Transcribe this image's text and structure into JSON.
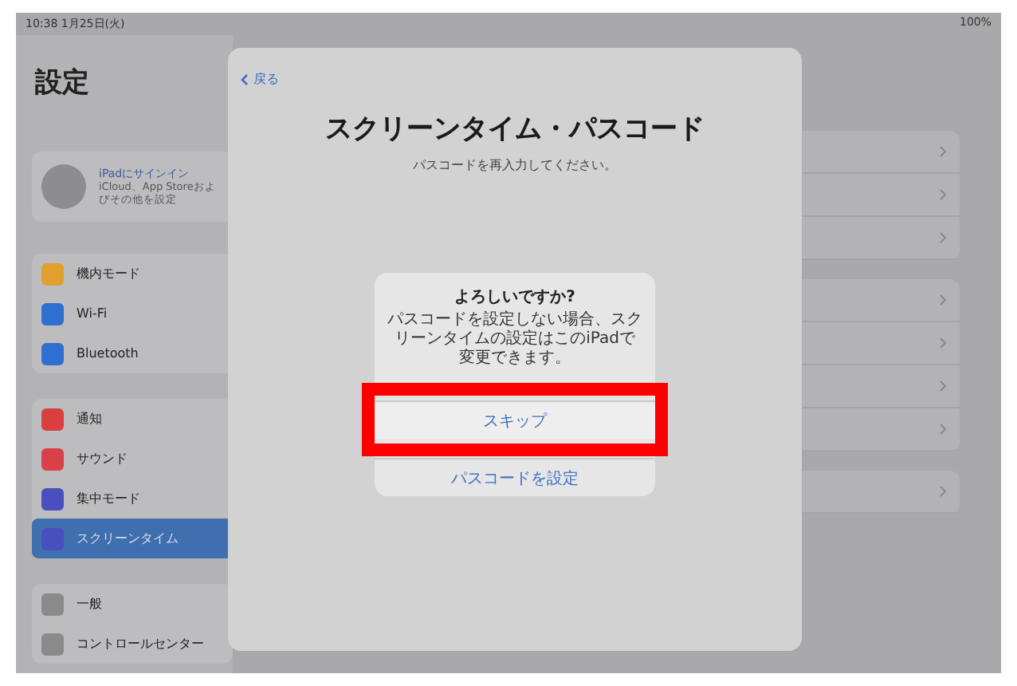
{
  "status_bar": {
    "time": "10:38 1月25日(火)",
    "battery": "100%"
  },
  "sidebar": {
    "title": "設定",
    "profile": {
      "name": "iPadにサインイン",
      "detail": "iCloud、App Storeおよびその他を設定"
    },
    "groups": [
      [
        {
          "label": "機内モード",
          "color": "#e0a030",
          "selected": false
        },
        {
          "label": "Wi-Fi",
          "color": "#2f6fd0",
          "selected": false
        },
        {
          "label": "Bluetooth",
          "color": "#2f6fd0",
          "selected": false
        }
      ],
      [
        {
          "label": "通知",
          "color": "#d84040",
          "selected": false
        },
        {
          "label": "サウンド",
          "color": "#d8404a",
          "selected": false
        },
        {
          "label": "集中モード",
          "color": "#4a4fc0",
          "selected": false
        },
        {
          "label": "スクリーンタイム",
          "color": "#4a4fc0",
          "selected": true
        }
      ],
      [
        {
          "label": "一般",
          "color": "#8a8a8a",
          "selected": false
        },
        {
          "label": "コントロールセンター",
          "color": "#8a8a8a",
          "selected": false
        }
      ]
    ]
  },
  "sheet": {
    "back": "戻る",
    "title": "スクリーンタイム・パスコード",
    "subtitle": "パスコードを再入力してください。",
    "alert": {
      "title": "よろしいですか?",
      "message": "パスコードを設定しない場合、スクリーンタイムの設定はこのiPadで変更できます。",
      "buttons": [
        {
          "label": "スキップ",
          "highlighted": true
        },
        {
          "label": "パスコードを設定",
          "highlighted": false
        }
      ]
    }
  }
}
